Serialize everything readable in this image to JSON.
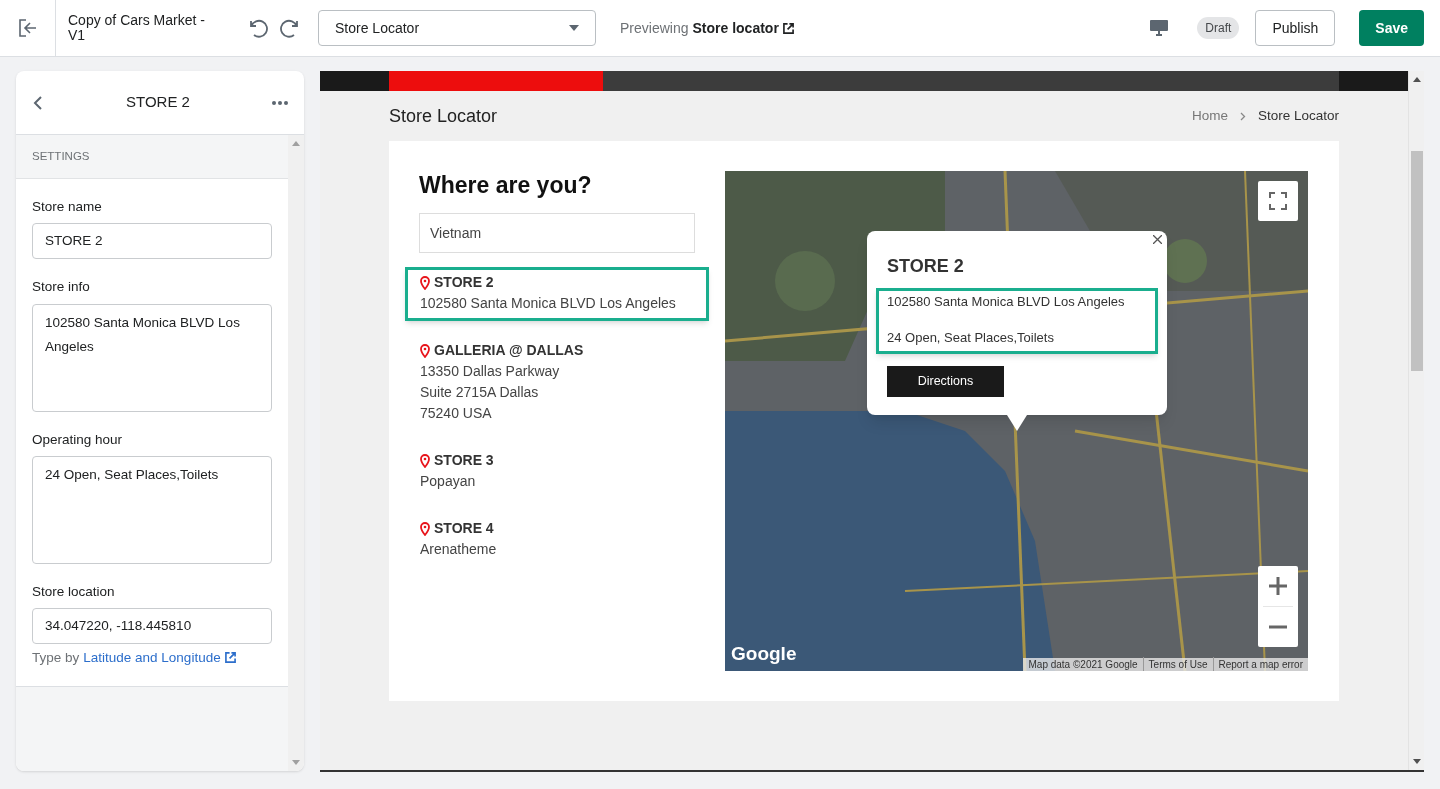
{
  "topbar": {
    "title": "Copy of Cars Market - V1",
    "page_select": "Store Locator",
    "previewing_label": "Previewing",
    "previewing_page": "Store locator",
    "status_badge": "Draft",
    "publish": "Publish",
    "save": "Save"
  },
  "panel": {
    "title": "STORE 2",
    "section": "SETTINGS",
    "fields": [
      {
        "kind": "input",
        "label": "Store name",
        "value": "STORE 2"
      },
      {
        "kind": "textarea",
        "label": "Store info",
        "value": "102580 Santa Monica BLVD Los Angeles"
      },
      {
        "kind": "textarea",
        "label": "Operating hour",
        "value": "24 Open, Seat Places,Toilets"
      },
      {
        "kind": "input",
        "label": "Store location",
        "value": "34.047220, -118.445810"
      }
    ],
    "help_text": "Type by",
    "help_link": "Latitude and Longitude"
  },
  "preview": {
    "page_title": "Store Locator",
    "breadcrumbs": [
      {
        "label": "Home"
      },
      {
        "label": "Store Locator"
      }
    ],
    "heading": "Where are you?",
    "search_value": "Vietnam",
    "stores": [
      {
        "name": "STORE 2",
        "lines": [
          "102580 Santa Monica BLVD Los Angeles"
        ],
        "highlighted": true
      },
      {
        "name": "GALLERIA @ DALLAS",
        "lines": [
          "13350 Dallas Parkway",
          "Suite 2715A Dallas",
          "75240 USA"
        ],
        "highlighted": false
      },
      {
        "name": "STORE 3",
        "lines": [
          "Popayan"
        ],
        "highlighted": false
      },
      {
        "name": "STORE 4",
        "lines": [
          "Arenatheme"
        ],
        "highlighted": false
      }
    ],
    "map": {
      "kind": "picture",
      "logo": "Google",
      "attribution": [
        "Map data ©2021 Google",
        "Terms of Use",
        "Report a map error"
      ],
      "popup": {
        "title": "STORE 2",
        "address": "102580 Santa Monica BLVD Los Angeles",
        "hours": "24 Open, Seat Places,Toilets",
        "highlighted": true,
        "button": "Directions"
      }
    }
  }
}
